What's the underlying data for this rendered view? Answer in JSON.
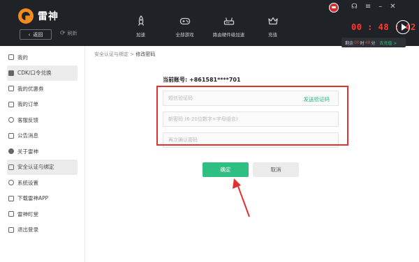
{
  "app": {
    "name": "雷神",
    "back_label": "返回",
    "refresh_label": "刷新"
  },
  "nav": [
    {
      "label": "加速",
      "icon": "rocket-icon"
    },
    {
      "label": "全部游戏",
      "icon": "gamepad-icon"
    },
    {
      "label": "路由硬件级加速",
      "icon": "router-icon"
    },
    {
      "label": "充值",
      "icon": "crown-icon"
    }
  ],
  "status": {
    "timer": "00 : 48 : 42",
    "remain_prefix": "剩余",
    "remain_hours": "00",
    "remain_hour_unit": "时",
    "remain_minutes": "48",
    "remain_minute_unit": "分",
    "renew_label": "去充值 >"
  },
  "sidebar": {
    "items": [
      {
        "label": "我的",
        "icon": "user-icon"
      },
      {
        "label": "CDK/口令兑换",
        "icon": "cdk-icon",
        "active": true
      },
      {
        "label": "我的优惠券",
        "icon": "coupon-icon"
      },
      {
        "label": "我的订单",
        "icon": "order-icon"
      },
      {
        "label": "客服反馈",
        "icon": "feedback-icon"
      },
      {
        "label": "公告消息",
        "icon": "announcement-icon"
      },
      {
        "label": "关于雷神",
        "icon": "info-icon"
      },
      {
        "label": "安全认证与绑定",
        "icon": "shield-icon",
        "active": true
      },
      {
        "label": "系统设置",
        "icon": "gear-icon"
      },
      {
        "label": "下载雷神APP",
        "icon": "phone-icon"
      },
      {
        "label": "雷神町堂",
        "icon": "hall-icon"
      },
      {
        "label": "退出登录",
        "icon": "logout-icon"
      }
    ]
  },
  "breadcrumb": {
    "parent": "安全认证与绑定",
    "separator": " > ",
    "current": "修改密码"
  },
  "form": {
    "account_label": "当前账号:",
    "account_value": "+861581****701",
    "code_placeholder": "短信验证码",
    "send_code_label": "发送验证码",
    "new_password_placeholder": "新密码 (6-20位数字+字母组合)",
    "confirm_placeholder": "再次确认密码",
    "ok_label": "确定",
    "cancel_label": "取消"
  },
  "colors": {
    "accent": "#2fbf83",
    "highlight": "#e13030",
    "timer": "#ff3b30"
  }
}
